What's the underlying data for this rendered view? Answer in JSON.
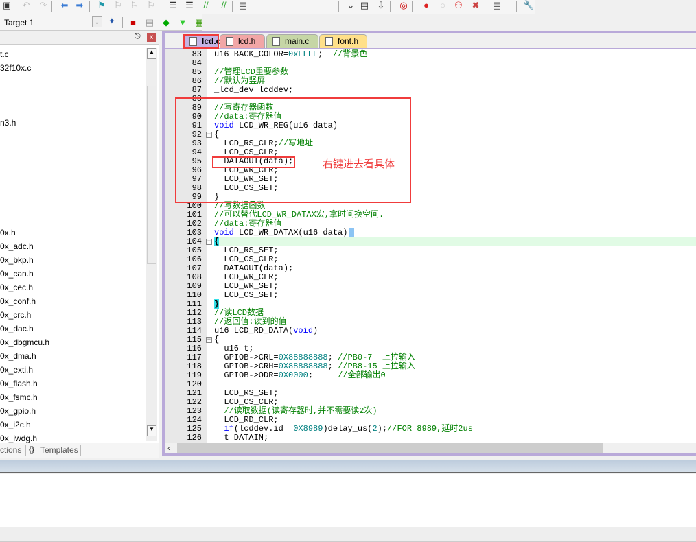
{
  "toolbar": {
    "icons": [
      "save-all-icon",
      "undo-icon",
      "redo-icon",
      "nav-back-icon",
      "nav-forward-icon",
      "bookmark-icon",
      "bookmark-prev-icon",
      "bookmark-next-icon",
      "bookmark-clear-icon",
      "indent-icon",
      "unindent-icon",
      "comment-icon",
      "uncomment-icon",
      "find-in-files-icon",
      "dropdown-icon",
      "find-icon",
      "incremental-find-icon",
      "debug-icon",
      "breakpoint-icon",
      "breakpoint-disable-icon",
      "breakpoint-disable-all-icon",
      "breakpoint-kill-all-icon",
      "window-layout-icon",
      "configure-icon"
    ]
  },
  "build_toolbar": {
    "target": "Target 1"
  },
  "project_panel": {
    "files": [
      "t.c",
      "32f10x.c",
      "",
      "",
      "",
      "n3.h",
      "",
      "",
      "",
      "",
      "",
      "",
      "",
      "0x.h",
      "0x_adc.h",
      "0x_bkp.h",
      "0x_can.h",
      "0x_cec.h",
      "0x_conf.h",
      "0x_crc.h",
      "0x_dac.h",
      "0x_dbgmcu.h",
      "0x_dma.h",
      "0x_exti.h",
      "0x_flash.h",
      "0x_fsmc.h",
      "0x_gpio.h",
      "0x_i2c.h",
      "0x_iwdg.h"
    ],
    "tabs": [
      "ctions",
      "Templates"
    ]
  },
  "editor": {
    "tabs": [
      {
        "label": "lcd.c",
        "active": true,
        "color": "#c4b4e4"
      },
      {
        "label": "lcd.h",
        "color": "#f2a6a6"
      },
      {
        "label": "main.c",
        "color": "#c6d6a6"
      },
      {
        "label": "font.h",
        "color": "#ffe08a"
      }
    ],
    "highlight_line": 104,
    "lines": [
      {
        "n": 83,
        "s": [
          [
            "",
            "u16 BACK_COLOR="
          ],
          [
            "n",
            "0xFFFF"
          ],
          [
            "",
            ";  "
          ],
          [
            "m",
            "//背景色"
          ]
        ]
      },
      {
        "n": 84,
        "s": []
      },
      {
        "n": 85,
        "s": [
          [
            "m",
            "//管理LCD重要参数"
          ]
        ]
      },
      {
        "n": 86,
        "s": [
          [
            "m",
            "//默认为竖屏"
          ]
        ]
      },
      {
        "n": 87,
        "s": [
          [
            "",
            "_lcd_dev lcddev;"
          ]
        ]
      },
      {
        "n": 88,
        "s": []
      },
      {
        "n": 89,
        "s": [
          [
            "m",
            "//写寄存器函数"
          ]
        ]
      },
      {
        "n": 90,
        "s": [
          [
            "m",
            "//data:寄存器值"
          ]
        ]
      },
      {
        "n": 91,
        "s": [
          [
            "k",
            "void"
          ],
          [
            "",
            " LCD_WR_REG(u16 data)"
          ]
        ]
      },
      {
        "n": 92,
        "s": [
          [
            "",
            "{"
          ]
        ],
        "f": "open"
      },
      {
        "n": 93,
        "s": [
          [
            "",
            "  LCD_RS_CLR;"
          ],
          [
            "m",
            "//写地址"
          ]
        ]
      },
      {
        "n": 94,
        "s": [
          [
            "",
            "  LCD_CS_CLR;"
          ]
        ]
      },
      {
        "n": 95,
        "s": [
          [
            "",
            "  DATAOUT(data);"
          ]
        ]
      },
      {
        "n": 96,
        "s": [
          [
            "",
            "  LCD_WR_CLR;"
          ]
        ]
      },
      {
        "n": 97,
        "s": [
          [
            "",
            "  LCD_WR_SET;"
          ]
        ]
      },
      {
        "n": 98,
        "s": [
          [
            "",
            "  LCD_CS_SET;"
          ]
        ]
      },
      {
        "n": 99,
        "s": [
          [
            "",
            "}"
          ]
        ],
        "f": "end"
      },
      {
        "n": 100,
        "s": [
          [
            "m",
            "//写数据函数"
          ]
        ]
      },
      {
        "n": 101,
        "s": [
          [
            "m",
            "//可以替代LCD_WR_DATAX宏,拿时间换空间."
          ]
        ]
      },
      {
        "n": 102,
        "s": [
          [
            "m",
            "//data:寄存器值"
          ]
        ]
      },
      {
        "n": 103,
        "s": [
          [
            "k",
            "void"
          ],
          [
            "",
            " LCD_WR_DATAX(u16 data)"
          ]
        ]
      },
      {
        "n": 104,
        "s": [
          [
            "b",
            "{"
          ]
        ],
        "f": "open"
      },
      {
        "n": 105,
        "s": [
          [
            "",
            "  LCD_RS_SET;"
          ]
        ]
      },
      {
        "n": 106,
        "s": [
          [
            "",
            "  LCD_CS_CLR;"
          ]
        ]
      },
      {
        "n": 107,
        "s": [
          [
            "",
            "  DATAOUT(data);"
          ]
        ]
      },
      {
        "n": 108,
        "s": [
          [
            "",
            "  LCD_WR_CLR;"
          ]
        ]
      },
      {
        "n": 109,
        "s": [
          [
            "",
            "  LCD_WR_SET;"
          ]
        ]
      },
      {
        "n": 110,
        "s": [
          [
            "",
            "  LCD_CS_SET;"
          ]
        ]
      },
      {
        "n": 111,
        "s": [
          [
            "b",
            "}"
          ]
        ],
        "f": "end"
      },
      {
        "n": 112,
        "s": [
          [
            "m",
            "//读LCD数据"
          ]
        ]
      },
      {
        "n": 113,
        "s": [
          [
            "m",
            "//返回值:读到的值"
          ]
        ]
      },
      {
        "n": 114,
        "s": [
          [
            "",
            "u16 LCD_RD_DATA("
          ],
          [
            "k",
            "void"
          ],
          [
            "",
            ")"
          ]
        ]
      },
      {
        "n": 115,
        "s": [
          [
            "",
            "{"
          ]
        ],
        "f": "open"
      },
      {
        "n": 116,
        "s": [
          [
            "",
            "  u16 t;"
          ]
        ]
      },
      {
        "n": 117,
        "s": [
          [
            "",
            "  GPIOB->CRL="
          ],
          [
            "n",
            "0X88888888"
          ],
          [
            "",
            "; "
          ],
          [
            "m",
            "//PB0-7  上拉输入"
          ]
        ]
      },
      {
        "n": 118,
        "s": [
          [
            "",
            "  GPIOB->CRH="
          ],
          [
            "n",
            "0X88888888"
          ],
          [
            "",
            "; "
          ],
          [
            "m",
            "//PB8-15 上拉输入"
          ]
        ]
      },
      {
        "n": 119,
        "s": [
          [
            "",
            "  GPIOB->ODR="
          ],
          [
            "n",
            "0X0000"
          ],
          [
            "",
            ";     "
          ],
          [
            "m",
            "//全部输出0"
          ]
        ]
      },
      {
        "n": 120,
        "s": []
      },
      {
        "n": 121,
        "s": [
          [
            "",
            "  LCD_RS_SET;"
          ]
        ]
      },
      {
        "n": 122,
        "s": [
          [
            "",
            "  LCD_CS_CLR;"
          ]
        ]
      },
      {
        "n": 123,
        "s": [
          [
            "m",
            "  //读取数据(读寄存器时,并不需要读2次)"
          ]
        ]
      },
      {
        "n": 124,
        "s": [
          [
            "",
            "  LCD_RD_CLR;"
          ]
        ]
      },
      {
        "n": 125,
        "s": [
          [
            "k",
            "  if"
          ],
          [
            "",
            "(lcddev.id=="
          ],
          [
            "n",
            "0X8989"
          ],
          [
            "",
            ")delay_us("
          ],
          [
            "n",
            "2"
          ],
          [
            "",
            ");"
          ],
          [
            "m",
            "//FOR 8989,延时2us"
          ]
        ]
      },
      {
        "n": 126,
        "s": [
          [
            "",
            "  t=DATAIN;"
          ]
        ]
      }
    ]
  },
  "annotation": {
    "text": "右键进去看具体",
    "color": "#f03c3c"
  }
}
